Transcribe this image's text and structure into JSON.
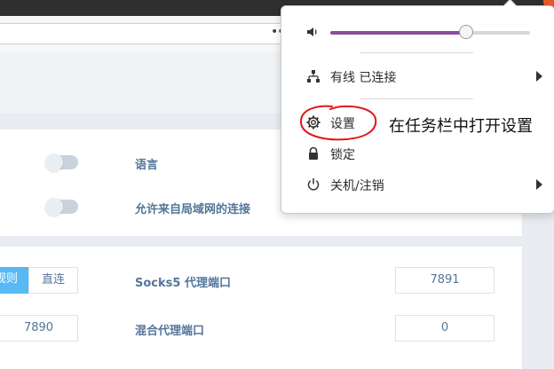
{
  "browser": {
    "more_dots": "•••"
  },
  "settings": {
    "rows_top": [
      {
        "label": "语言"
      },
      {
        "label": "允许来自局域网的连接"
      }
    ],
    "mode_segment": {
      "active_partial": "规则",
      "direct": "直连"
    },
    "http_port": "7890",
    "socks5_label": "Socks5 代理端口",
    "socks5_port": "7891",
    "mixed_label": "混合代理端口",
    "mixed_port": "0"
  },
  "tray_menu": {
    "volume_level": 0.68,
    "accent_color": "#8a4d9d",
    "network_label": "有线 已连接",
    "settings_label": "设置",
    "lock_label": "锁定",
    "power_label": "关机/注销"
  },
  "annotation": {
    "text": "在任务栏中打开设置",
    "oval_color": "#e01818"
  },
  "icons": [
    "speaker-icon",
    "network-icon",
    "gear-icon",
    "lock-icon",
    "power-icon",
    "chevron-right-icon"
  ]
}
